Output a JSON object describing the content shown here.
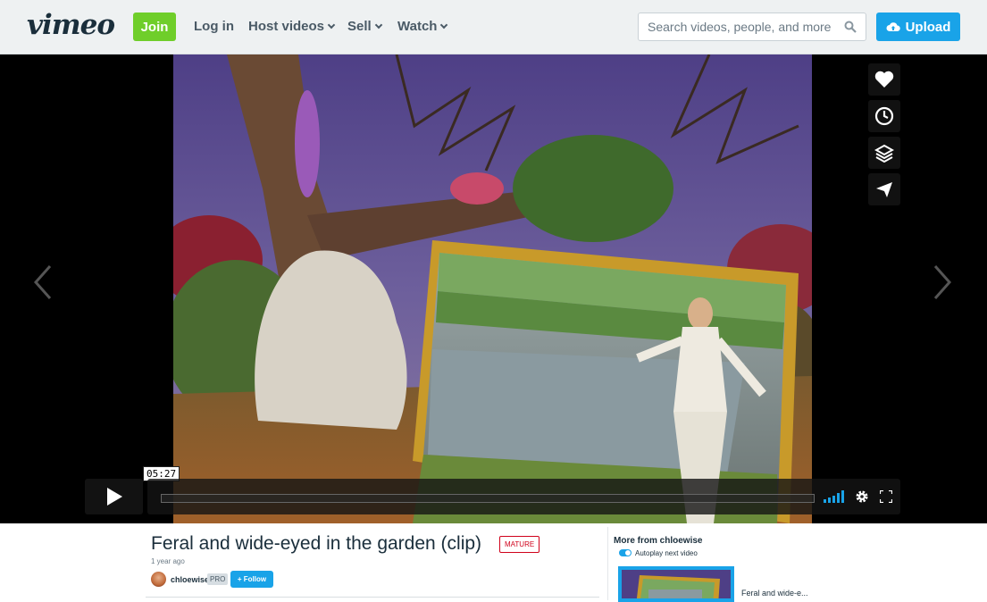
{
  "header": {
    "logo": "vimeo",
    "join": "Join",
    "login": "Log in",
    "host_videos": "Host videos",
    "sell": "Sell",
    "watch": "Watch",
    "search_placeholder": "Search videos, people, and more",
    "upload": "Upload"
  },
  "player": {
    "timecode": "05:27",
    "side_actions": [
      "heart-icon",
      "clock-icon",
      "layers-icon",
      "send-icon"
    ],
    "playing": false
  },
  "video_info": {
    "title": "Feral and wide-eyed in the garden (clip)",
    "rating_badge": "MATURE",
    "posted": "1 year ago",
    "uploader": "chloewise",
    "badge": "PRO",
    "follow": "+ Follow"
  },
  "sidebar": {
    "heading": "More from chloewise",
    "autoplay_label": "Autoplay next video",
    "autoplay_on": true,
    "next_video_title": "Feral and wide-e..."
  },
  "colors": {
    "brand_green": "#6fce2a",
    "brand_blue": "#19a3e8",
    "mature_red": "#d0021b"
  }
}
